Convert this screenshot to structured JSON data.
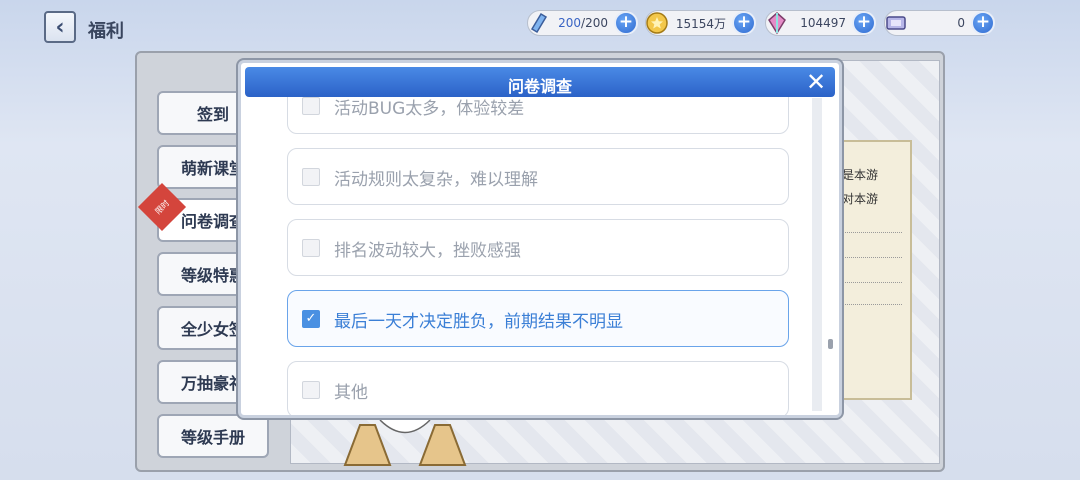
{
  "header": {
    "title": "福利",
    "back_icon": "chevron-left-icon"
  },
  "resources": [
    {
      "icon": "stamina-icon",
      "value": "200",
      "max": "/200"
    },
    {
      "icon": "coin-icon",
      "value": "15154万"
    },
    {
      "icon": "gem-icon",
      "value": "104497"
    },
    {
      "icon": "ticket-icon",
      "value": "0"
    }
  ],
  "sidebar": {
    "items": [
      {
        "label": "签到"
      },
      {
        "label": "萌新课堂"
      },
      {
        "label": "问卷调查",
        "badge": "限时"
      },
      {
        "label": "等级特惠"
      },
      {
        "label": "全少女签"
      },
      {
        "label": "万抽豪礼"
      },
      {
        "label": "等级手册"
      }
    ]
  },
  "notice": {
    "lines": [
      "是本游",
      "对本游"
    ]
  },
  "dialog": {
    "title": "问卷调查",
    "options": [
      {
        "label": "活动BUG太多，体验较差",
        "checked": false
      },
      {
        "label": "活动规则太复杂，难以理解",
        "checked": false
      },
      {
        "label": "排名波动较大，挫败感强",
        "checked": false
      },
      {
        "label": "最后一天才决定胜负，前期结果不明显",
        "checked": true
      },
      {
        "label": "其他",
        "checked": false
      }
    ]
  },
  "colors": {
    "accent": "#3b7fd6",
    "header_blue": "#2b62c7"
  }
}
